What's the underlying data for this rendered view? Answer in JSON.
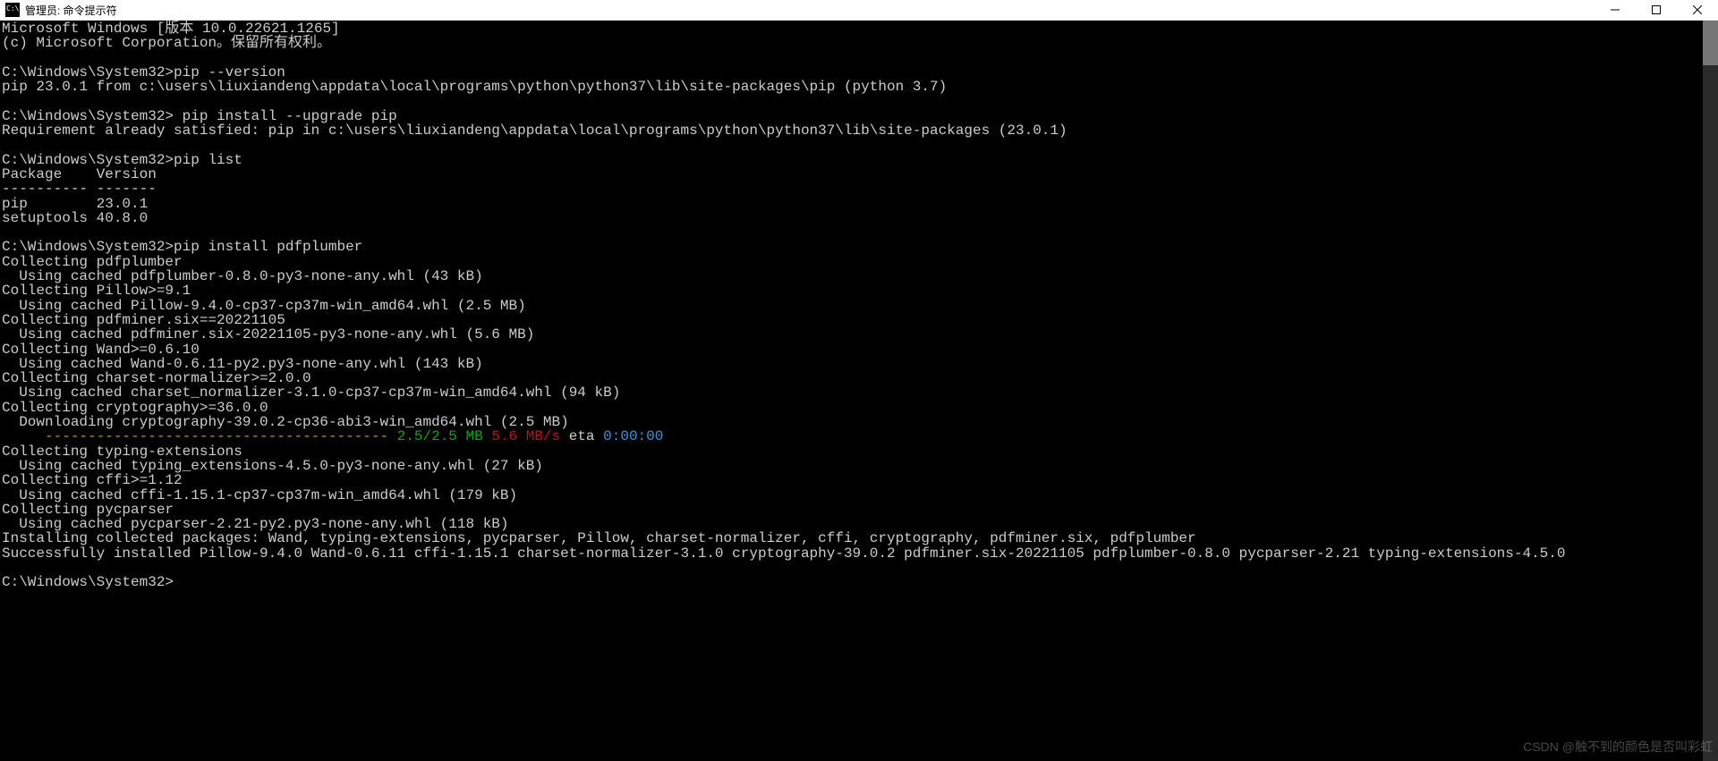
{
  "window": {
    "title": "管理员: 命令提示符"
  },
  "console": {
    "lines": [
      {
        "segments": [
          {
            "cls": "w",
            "text": "Microsoft Windows [版本 10.0.22621.1265]"
          }
        ]
      },
      {
        "segments": [
          {
            "cls": "w",
            "text": "(c) Microsoft Corporation。保留所有权利。"
          }
        ]
      },
      {
        "segments": []
      },
      {
        "segments": [
          {
            "cls": "w",
            "text": "C:\\Windows\\System32>pip --version"
          }
        ]
      },
      {
        "segments": [
          {
            "cls": "w",
            "text": "pip 23.0.1 from c:\\users\\liuxiandeng\\appdata\\local\\programs\\python\\python37\\lib\\site-packages\\pip (python 3.7)"
          }
        ]
      },
      {
        "segments": []
      },
      {
        "segments": [
          {
            "cls": "w",
            "text": "C:\\Windows\\System32> pip install --upgrade pip"
          }
        ]
      },
      {
        "segments": [
          {
            "cls": "w",
            "text": "Requirement already satisfied: pip in c:\\users\\liuxiandeng\\appdata\\local\\programs\\python\\python37\\lib\\site-packages (23.0.1)"
          }
        ]
      },
      {
        "segments": []
      },
      {
        "segments": [
          {
            "cls": "w",
            "text": "C:\\Windows\\System32>pip list"
          }
        ]
      },
      {
        "segments": [
          {
            "cls": "w",
            "text": "Package    Version"
          }
        ]
      },
      {
        "segments": [
          {
            "cls": "w",
            "text": "---------- -------"
          }
        ]
      },
      {
        "segments": [
          {
            "cls": "w",
            "text": "pip        23.0.1"
          }
        ]
      },
      {
        "segments": [
          {
            "cls": "w",
            "text": "setuptools 40.8.0"
          }
        ]
      },
      {
        "segments": []
      },
      {
        "segments": [
          {
            "cls": "w",
            "text": "C:\\Windows\\System32>pip install pdfplumber"
          }
        ]
      },
      {
        "segments": [
          {
            "cls": "w",
            "text": "Collecting pdfplumber"
          }
        ]
      },
      {
        "segments": [
          {
            "cls": "w",
            "text": "  Using cached pdfplumber-0.8.0-py3-none-any.whl (43 kB)"
          }
        ]
      },
      {
        "segments": [
          {
            "cls": "w",
            "text": "Collecting Pillow>=9.1"
          }
        ]
      },
      {
        "segments": [
          {
            "cls": "w",
            "text": "  Using cached Pillow-9.4.0-cp37-cp37m-win_amd64.whl (2.5 MB)"
          }
        ]
      },
      {
        "segments": [
          {
            "cls": "w",
            "text": "Collecting pdfminer.six==20221105"
          }
        ]
      },
      {
        "segments": [
          {
            "cls": "w",
            "text": "  Using cached pdfminer.six-20221105-py3-none-any.whl (5.6 MB)"
          }
        ]
      },
      {
        "segments": [
          {
            "cls": "w",
            "text": "Collecting Wand>=0.6.10"
          }
        ]
      },
      {
        "segments": [
          {
            "cls": "w",
            "text": "  Using cached Wand-0.6.11-py2.py3-none-any.whl (143 kB)"
          }
        ]
      },
      {
        "segments": [
          {
            "cls": "w",
            "text": "Collecting charset-normalizer>=2.0.0"
          }
        ]
      },
      {
        "segments": [
          {
            "cls": "w",
            "text": "  Using cached charset_normalizer-3.1.0-cp37-cp37m-win_amd64.whl (94 kB)"
          }
        ]
      },
      {
        "segments": [
          {
            "cls": "w",
            "text": "Collecting cryptography>=36.0.0"
          }
        ]
      },
      {
        "segments": [
          {
            "cls": "w",
            "text": "  Downloading cryptography-39.0.2-cp36-abi3-win_amd64.whl (2.5 MB)"
          }
        ]
      },
      {
        "segments": [
          {
            "cls": "w",
            "text": "     "
          },
          {
            "cls": "y",
            "text": "---------------------------------------- "
          },
          {
            "cls": "g",
            "text": "2.5/2.5 MB"
          },
          {
            "cls": "w",
            "text": " "
          },
          {
            "cls": "r",
            "text": "5.6 MB/s"
          },
          {
            "cls": "w",
            "text": " eta "
          },
          {
            "cls": "c",
            "text": "0:00:00"
          }
        ]
      },
      {
        "segments": [
          {
            "cls": "w",
            "text": "Collecting typing-extensions"
          }
        ]
      },
      {
        "segments": [
          {
            "cls": "w",
            "text": "  Using cached typing_extensions-4.5.0-py3-none-any.whl (27 kB)"
          }
        ]
      },
      {
        "segments": [
          {
            "cls": "w",
            "text": "Collecting cffi>=1.12"
          }
        ]
      },
      {
        "segments": [
          {
            "cls": "w",
            "text": "  Using cached cffi-1.15.1-cp37-cp37m-win_amd64.whl (179 kB)"
          }
        ]
      },
      {
        "segments": [
          {
            "cls": "w",
            "text": "Collecting pycparser"
          }
        ]
      },
      {
        "segments": [
          {
            "cls": "w",
            "text": "  Using cached pycparser-2.21-py2.py3-none-any.whl (118 kB)"
          }
        ]
      },
      {
        "segments": [
          {
            "cls": "w",
            "text": "Installing collected packages: Wand, typing-extensions, pycparser, Pillow, charset-normalizer, cffi, cryptography, pdfminer.six, pdfplumber"
          }
        ]
      },
      {
        "segments": [
          {
            "cls": "w",
            "text": "Successfully installed Pillow-9.4.0 Wand-0.6.11 cffi-1.15.1 charset-normalizer-3.1.0 cryptography-39.0.2 pdfminer.six-20221105 pdfplumber-0.8.0 pycparser-2.21 typing-extensions-4.5.0"
          }
        ]
      },
      {
        "segments": []
      },
      {
        "segments": [
          {
            "cls": "w",
            "text": "C:\\Windows\\System32>"
          }
        ]
      }
    ]
  },
  "watermark": "CSDN @触不到的颜色是否叫彩虹"
}
